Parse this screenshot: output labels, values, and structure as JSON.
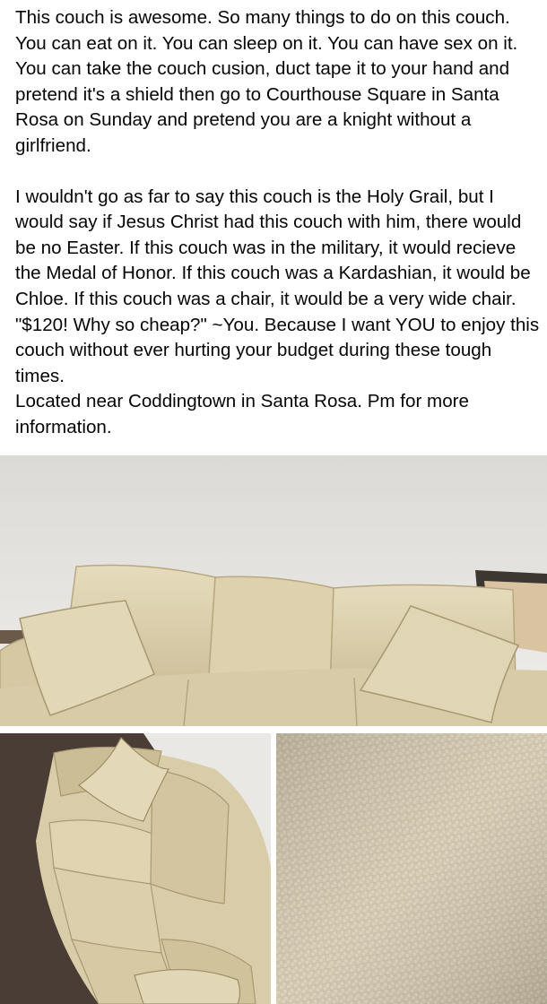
{
  "post": {
    "paragraphs": [
      "This couch is awesome. So many things to do on this couch. You can eat on it. You can sleep on it. You can have sex on it. You can take the couch cusion, duct tape it to your hand and pretend it's a shield then go to Courthouse Square in Santa Rosa on Sunday and pretend you are a knight without a girlfriend.",
      "I wouldn't go as far to say this couch is the Holy Grail, but I would say if Jesus Christ had this couch with him, there would be no Easter. If this couch was in the military, it would recieve the Medal of Honor. If this couch was a Kardashian, it would be Chloe. If this couch was a chair, it would be a very wide chair. \"$120! Why so cheap?\" ~You. Because I want YOU to enjoy this couch without ever hurting your budget during these tough times.",
      "Located near Coddingtown in Santa Rosa. Pm for more information."
    ]
  },
  "photos": [
    {
      "subject": "couch-front-view"
    },
    {
      "subject": "couch-side-view"
    },
    {
      "subject": "fabric-closeup"
    }
  ],
  "colors": {
    "text": "#050505",
    "wall": "#e6e4e1",
    "couch": "#ddd0ad",
    "couch_shadow": "#c2b38e",
    "carpet": "#4a3d36",
    "fabric": "#d7cdb7"
  }
}
